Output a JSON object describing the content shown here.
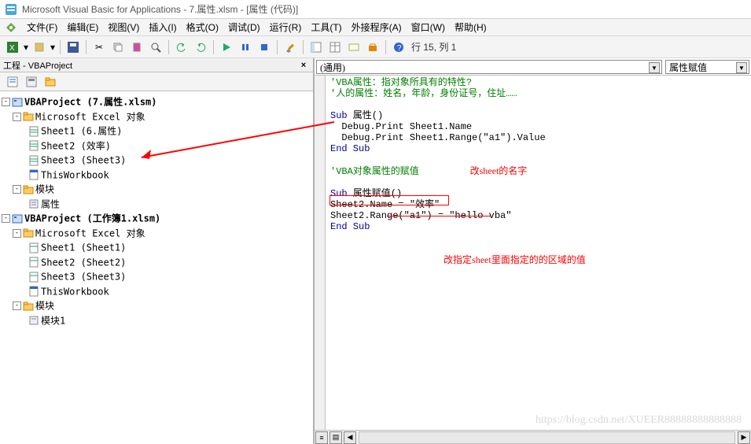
{
  "title": "Microsoft Visual Basic for Applications - 7.属性.xlsm - [属性 (代码)]",
  "menu": {
    "file": "文件(F)",
    "edit": "编辑(E)",
    "view": "视图(V)",
    "insert": "插入(I)",
    "format": "格式(O)",
    "debug": "调试(D)",
    "run": "运行(R)",
    "tools": "工具(T)",
    "addins": "外接程序(A)",
    "window": "窗口(W)",
    "help": "帮助(H)"
  },
  "toolbar_status": "行 15, 列 1",
  "panel_title": "工程 - VBAProject",
  "tree": {
    "p1": {
      "root": "VBAProject (7.属性.xlsm)",
      "excel": "Microsoft Excel 对象",
      "s1": "Sheet1 (6.属性)",
      "s2": "Sheet2 (效率)",
      "s3": "Sheet3 (Sheet3)",
      "tw": "ThisWorkbook",
      "modfolder": "模块",
      "mod": "属性"
    },
    "p2": {
      "root": "VBAProject (工作簿1.xlsm)",
      "excel": "Microsoft Excel 对象",
      "s1": "Sheet1 (Sheet1)",
      "s2": "Sheet2 (Sheet2)",
      "s3": "Sheet3 (Sheet3)",
      "tw": "ThisWorkbook",
      "modfolder": "模块",
      "mod": "模块1"
    }
  },
  "codehead": {
    "left": "(通用)",
    "right": "属性赋值"
  },
  "code": {
    "c1": "'VBA属性：指对象所具有的特性?",
    "c2": "'人的属性：姓名，年龄，身份证号，住址……",
    "c3": "Sub 属性()",
    "c4": " Debug.Print Sheet1.Name",
    "c5": " Debug.Print Sheet1.Range(\"a1\").Value",
    "c6": "End Sub",
    "c7": "'VBA对象属性的赋值",
    "a1": "改sheet的名字",
    "c8": "Sub 属性赋值()",
    "c9": "Sheet2.Name = \"效率\"",
    "c10": "Sheet2.Range(\"a1\") = \"hello vba\"",
    "c11": "End Sub",
    "a2": "改指定sheet里面指定的的区域的值"
  },
  "watermark": "https://blog.csdn.net/XUEER88888888888888"
}
